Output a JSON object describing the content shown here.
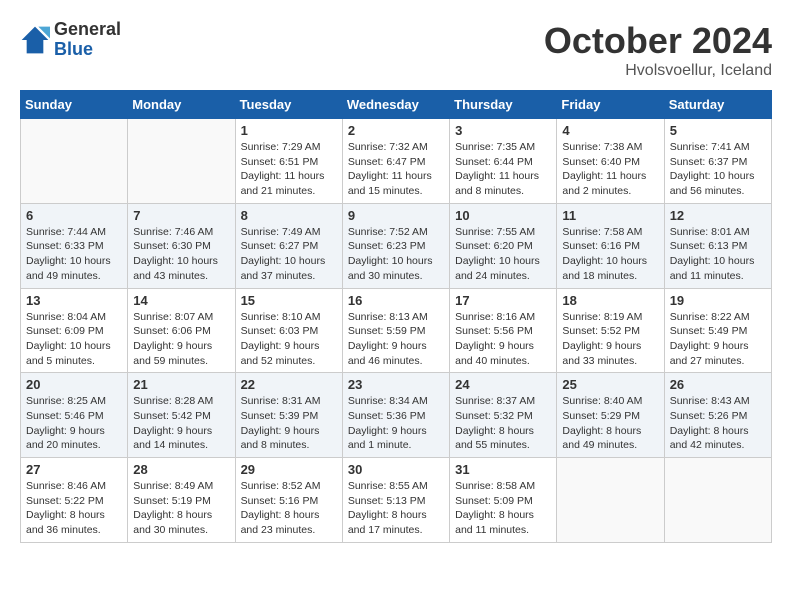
{
  "header": {
    "logo_general": "General",
    "logo_blue": "Blue",
    "month": "October 2024",
    "location": "Hvolsvoellur, Iceland"
  },
  "weekdays": [
    "Sunday",
    "Monday",
    "Tuesday",
    "Wednesday",
    "Thursday",
    "Friday",
    "Saturday"
  ],
  "weeks": [
    [
      {
        "day": "",
        "sunrise": "",
        "sunset": "",
        "daylight": ""
      },
      {
        "day": "",
        "sunrise": "",
        "sunset": "",
        "daylight": ""
      },
      {
        "day": "1",
        "sunrise": "Sunrise: 7:29 AM",
        "sunset": "Sunset: 6:51 PM",
        "daylight": "Daylight: 11 hours and 21 minutes."
      },
      {
        "day": "2",
        "sunrise": "Sunrise: 7:32 AM",
        "sunset": "Sunset: 6:47 PM",
        "daylight": "Daylight: 11 hours and 15 minutes."
      },
      {
        "day": "3",
        "sunrise": "Sunrise: 7:35 AM",
        "sunset": "Sunset: 6:44 PM",
        "daylight": "Daylight: 11 hours and 8 minutes."
      },
      {
        "day": "4",
        "sunrise": "Sunrise: 7:38 AM",
        "sunset": "Sunset: 6:40 PM",
        "daylight": "Daylight: 11 hours and 2 minutes."
      },
      {
        "day": "5",
        "sunrise": "Sunrise: 7:41 AM",
        "sunset": "Sunset: 6:37 PM",
        "daylight": "Daylight: 10 hours and 56 minutes."
      }
    ],
    [
      {
        "day": "6",
        "sunrise": "Sunrise: 7:44 AM",
        "sunset": "Sunset: 6:33 PM",
        "daylight": "Daylight: 10 hours and 49 minutes."
      },
      {
        "day": "7",
        "sunrise": "Sunrise: 7:46 AM",
        "sunset": "Sunset: 6:30 PM",
        "daylight": "Daylight: 10 hours and 43 minutes."
      },
      {
        "day": "8",
        "sunrise": "Sunrise: 7:49 AM",
        "sunset": "Sunset: 6:27 PM",
        "daylight": "Daylight: 10 hours and 37 minutes."
      },
      {
        "day": "9",
        "sunrise": "Sunrise: 7:52 AM",
        "sunset": "Sunset: 6:23 PM",
        "daylight": "Daylight: 10 hours and 30 minutes."
      },
      {
        "day": "10",
        "sunrise": "Sunrise: 7:55 AM",
        "sunset": "Sunset: 6:20 PM",
        "daylight": "Daylight: 10 hours and 24 minutes."
      },
      {
        "day": "11",
        "sunrise": "Sunrise: 7:58 AM",
        "sunset": "Sunset: 6:16 PM",
        "daylight": "Daylight: 10 hours and 18 minutes."
      },
      {
        "day": "12",
        "sunrise": "Sunrise: 8:01 AM",
        "sunset": "Sunset: 6:13 PM",
        "daylight": "Daylight: 10 hours and 11 minutes."
      }
    ],
    [
      {
        "day": "13",
        "sunrise": "Sunrise: 8:04 AM",
        "sunset": "Sunset: 6:09 PM",
        "daylight": "Daylight: 10 hours and 5 minutes."
      },
      {
        "day": "14",
        "sunrise": "Sunrise: 8:07 AM",
        "sunset": "Sunset: 6:06 PM",
        "daylight": "Daylight: 9 hours and 59 minutes."
      },
      {
        "day": "15",
        "sunrise": "Sunrise: 8:10 AM",
        "sunset": "Sunset: 6:03 PM",
        "daylight": "Daylight: 9 hours and 52 minutes."
      },
      {
        "day": "16",
        "sunrise": "Sunrise: 8:13 AM",
        "sunset": "Sunset: 5:59 PM",
        "daylight": "Daylight: 9 hours and 46 minutes."
      },
      {
        "day": "17",
        "sunrise": "Sunrise: 8:16 AM",
        "sunset": "Sunset: 5:56 PM",
        "daylight": "Daylight: 9 hours and 40 minutes."
      },
      {
        "day": "18",
        "sunrise": "Sunrise: 8:19 AM",
        "sunset": "Sunset: 5:52 PM",
        "daylight": "Daylight: 9 hours and 33 minutes."
      },
      {
        "day": "19",
        "sunrise": "Sunrise: 8:22 AM",
        "sunset": "Sunset: 5:49 PM",
        "daylight": "Daylight: 9 hours and 27 minutes."
      }
    ],
    [
      {
        "day": "20",
        "sunrise": "Sunrise: 8:25 AM",
        "sunset": "Sunset: 5:46 PM",
        "daylight": "Daylight: 9 hours and 20 minutes."
      },
      {
        "day": "21",
        "sunrise": "Sunrise: 8:28 AM",
        "sunset": "Sunset: 5:42 PM",
        "daylight": "Daylight: 9 hours and 14 minutes."
      },
      {
        "day": "22",
        "sunrise": "Sunrise: 8:31 AM",
        "sunset": "Sunset: 5:39 PM",
        "daylight": "Daylight: 9 hours and 8 minutes."
      },
      {
        "day": "23",
        "sunrise": "Sunrise: 8:34 AM",
        "sunset": "Sunset: 5:36 PM",
        "daylight": "Daylight: 9 hours and 1 minute."
      },
      {
        "day": "24",
        "sunrise": "Sunrise: 8:37 AM",
        "sunset": "Sunset: 5:32 PM",
        "daylight": "Daylight: 8 hours and 55 minutes."
      },
      {
        "day": "25",
        "sunrise": "Sunrise: 8:40 AM",
        "sunset": "Sunset: 5:29 PM",
        "daylight": "Daylight: 8 hours and 49 minutes."
      },
      {
        "day": "26",
        "sunrise": "Sunrise: 8:43 AM",
        "sunset": "Sunset: 5:26 PM",
        "daylight": "Daylight: 8 hours and 42 minutes."
      }
    ],
    [
      {
        "day": "27",
        "sunrise": "Sunrise: 8:46 AM",
        "sunset": "Sunset: 5:22 PM",
        "daylight": "Daylight: 8 hours and 36 minutes."
      },
      {
        "day": "28",
        "sunrise": "Sunrise: 8:49 AM",
        "sunset": "Sunset: 5:19 PM",
        "daylight": "Daylight: 8 hours and 30 minutes."
      },
      {
        "day": "29",
        "sunrise": "Sunrise: 8:52 AM",
        "sunset": "Sunset: 5:16 PM",
        "daylight": "Daylight: 8 hours and 23 minutes."
      },
      {
        "day": "30",
        "sunrise": "Sunrise: 8:55 AM",
        "sunset": "Sunset: 5:13 PM",
        "daylight": "Daylight: 8 hours and 17 minutes."
      },
      {
        "day": "31",
        "sunrise": "Sunrise: 8:58 AM",
        "sunset": "Sunset: 5:09 PM",
        "daylight": "Daylight: 8 hours and 11 minutes."
      },
      {
        "day": "",
        "sunrise": "",
        "sunset": "",
        "daylight": ""
      },
      {
        "day": "",
        "sunrise": "",
        "sunset": "",
        "daylight": ""
      }
    ]
  ]
}
